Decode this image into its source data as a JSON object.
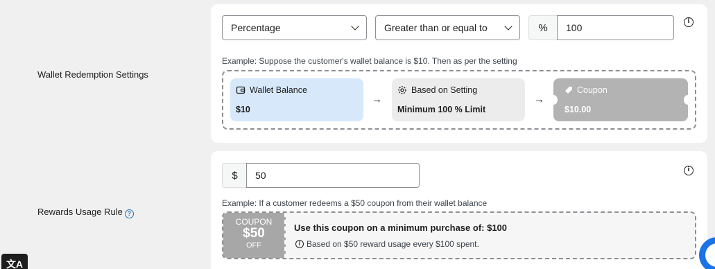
{
  "wallet_redemption": {
    "label": "Wallet Redemption Settings",
    "type_select": "Percentage",
    "condition_select": "Greater than or equal to",
    "unit_symbol": "%",
    "amount_value": "100",
    "example_text": "Example: Suppose the customer's wallet balance is $10. Then as per the setting",
    "flow": {
      "wallet_title": "Wallet Balance",
      "wallet_value": "$10",
      "setting_title": "Based on Setting",
      "setting_value": "Minimum 100 % Limit",
      "coupon_title": "Coupon",
      "coupon_value": "$10.00",
      "arrow": "→"
    },
    "colors": {
      "wallet_tile": "#d7e8fb",
      "setting_tile": "#ececec",
      "coupon_tile": "#b3b3b3"
    }
  },
  "rewards_usage": {
    "label": "Rewards Usage Rule",
    "help_icon": "?",
    "currency_symbol": "$",
    "amount_value": "50",
    "example_text": "Example: If a customer redeems a $50 coupon from their wallet balance",
    "coupon": {
      "stub_top": "COUPON",
      "stub_amount": "$50",
      "stub_bottom": "OFF",
      "headline": "Use this coupon on a minimum purchase of: $100",
      "note": "Based on $50 reward usage every $100 spent."
    }
  },
  "info_icon": "i",
  "translate_button": "文A"
}
